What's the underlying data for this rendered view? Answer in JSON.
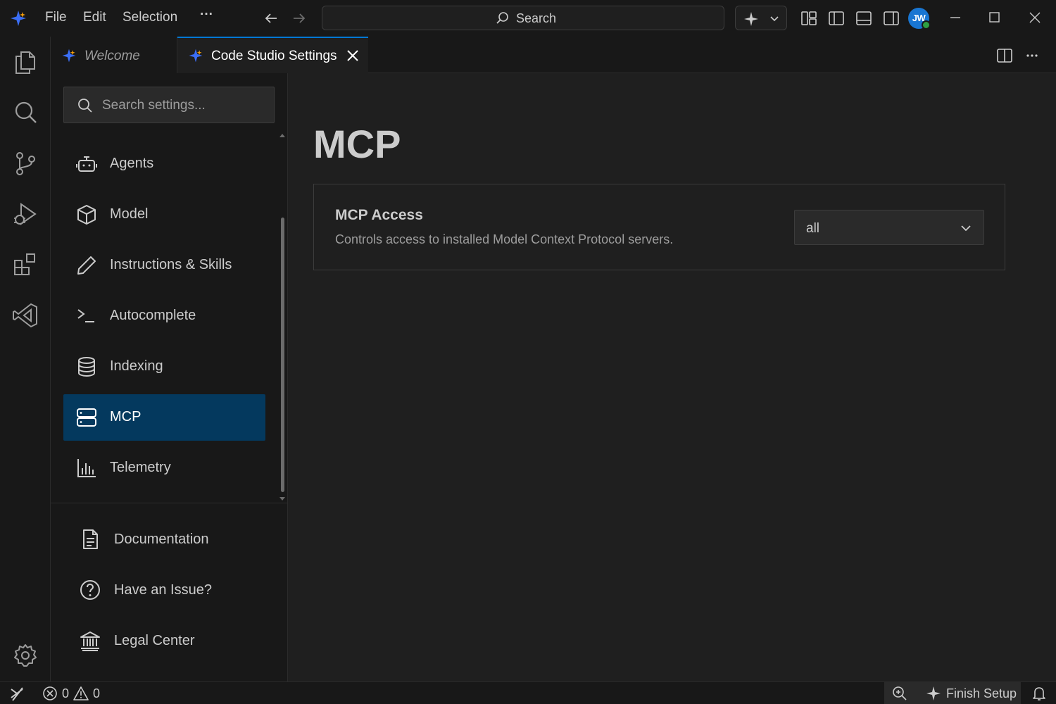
{
  "menu": {
    "file": "File",
    "edit": "Edit",
    "selection": "Selection",
    "more": "···"
  },
  "search": {
    "label": "Search"
  },
  "user": {
    "initials": "JW"
  },
  "tabs": [
    {
      "label": "Welcome",
      "active": false
    },
    {
      "label": "Code Studio Settings",
      "active": true
    }
  ],
  "settings_nav": {
    "search_placeholder": "Search settings...",
    "items": [
      {
        "label": "Agents",
        "icon": "robot-icon"
      },
      {
        "label": "Model",
        "icon": "cube-icon"
      },
      {
        "label": "Instructions & Skills",
        "icon": "pencil-icon"
      },
      {
        "label": "Autocomplete",
        "icon": "terminal-prompt-icon"
      },
      {
        "label": "Indexing",
        "icon": "database-icon"
      },
      {
        "label": "MCP",
        "icon": "server-icon",
        "active": true
      },
      {
        "label": "Telemetry",
        "icon": "bar-chart-icon"
      }
    ],
    "links": [
      {
        "label": "Documentation",
        "icon": "document-icon"
      },
      {
        "label": "Have an Issue?",
        "icon": "question-circle-icon"
      },
      {
        "label": "Legal Center",
        "icon": "bank-icon"
      }
    ]
  },
  "main": {
    "title": "MCP",
    "setting": {
      "title": "MCP Access",
      "description": "Controls access to installed Model Context Protocol servers.",
      "value": "all"
    }
  },
  "statusbar": {
    "errors": "0",
    "warnings": "0",
    "finish_setup": "Finish Setup"
  },
  "colors": {
    "accent": "#0078d4",
    "active_item_bg": "#04395e",
    "avatar_bg": "#1976d2",
    "presence": "#2ea043"
  }
}
